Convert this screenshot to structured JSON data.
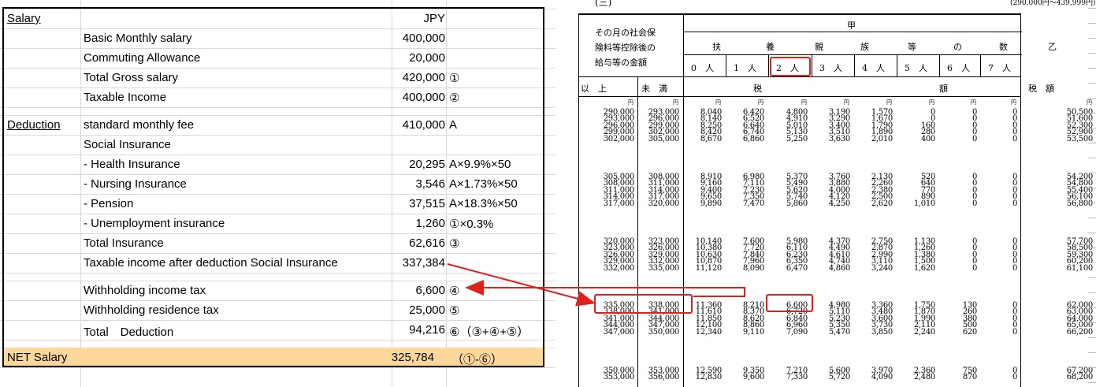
{
  "salary_sheet": {
    "rows": [
      {
        "label": "Salary",
        "item": "",
        "value": "JPY",
        "note": ""
      },
      {
        "label": "",
        "item": "Basic Monthly salary",
        "value": "400,000",
        "note": ""
      },
      {
        "label": "",
        "item": "Commuting Allowance",
        "value": "20,000",
        "note": ""
      },
      {
        "label": "",
        "item": "Total Gross salary",
        "value": "420,000",
        "note": "①"
      },
      {
        "label": "",
        "item": "Taxable Income",
        "value": "400,000",
        "note": "②"
      },
      {
        "label": "Deduction",
        "item": "standard monthly fee",
        "value": "410,000",
        "note": "A"
      },
      {
        "label": "",
        "item": "Social Insurance",
        "value": "",
        "note": ""
      },
      {
        "label": "",
        "item": "-  Health Insurance",
        "value": "20,295",
        "note": "A×9.9%×50"
      },
      {
        "label": "",
        "item": "-  Nursing Insurance",
        "value": "3,546",
        "note": "A×1.73%×50"
      },
      {
        "label": "",
        "item": "-  Pension",
        "value": "37,515",
        "note": "A×18.3%×50"
      },
      {
        "label": "",
        "item": "-  Unemployment insurance",
        "value": "1,260",
        "note": "①×0.3%"
      },
      {
        "label": "",
        "item": "Total Insurance",
        "value": "62,616",
        "note": "③"
      },
      {
        "label": "",
        "item": "Taxable income after deduction Social Insurance",
        "value": "337,384",
        "note": ""
      },
      {
        "label": "",
        "item": "Withholding income tax",
        "value": "6,600",
        "note": "④"
      },
      {
        "label": "",
        "item": "Withholding residence tax",
        "value": "25,000",
        "note": "⑤"
      },
      {
        "label": "",
        "item": "Total　Deduction",
        "value": "94,216",
        "note": "⑥（③+④+⑤）"
      },
      {
        "label": "NET Salary",
        "item": "",
        "value": "325,784",
        "note": "（①-⑥）"
      }
    ]
  },
  "tax_table": {
    "section_label": "(三)",
    "range_label": "(290,000円～439,999円)",
    "header": {
      "income_col": [
        "その月の社会保",
        "険料等控除後の",
        "給与等の金額"
      ],
      "kou": "甲",
      "dependents_title": [
        "扶",
        "養",
        "親",
        "族",
        "等",
        "の",
        "数"
      ],
      "dependents": [
        "0　人",
        "1　人",
        "2　人",
        "3　人",
        "4　人",
        "5　人",
        "6　人",
        "7　人"
      ],
      "otsu": "乙",
      "ijou": "以　上",
      "miman": "未　満",
      "zei": "税",
      "gaku": "額",
      "zeigaku": "税　額",
      "yen": "円"
    },
    "groups": [
      {
        "from": [
          "290,000",
          "293,000",
          "296,000",
          "299,000",
          "302,000"
        ],
        "to": [
          "293,000",
          "296,000",
          "299,000",
          "302,000",
          "305,000"
        ],
        "d0": [
          "8,040",
          "8,140",
          "8,250",
          "8,420",
          "8,670"
        ],
        "d1": [
          "6,420",
          "6,520",
          "6,640",
          "6,740",
          "6,860"
        ],
        "d2": [
          "4,800",
          "4,910",
          "5,010",
          "5,130",
          "5,250"
        ],
        "d3": [
          "3,190",
          "3,290",
          "3,400",
          "3,510",
          "3,630"
        ],
        "d4": [
          "1,570",
          "1,670",
          "1,790",
          "1,890",
          "2,010"
        ],
        "d5": [
          "0",
          "0",
          "160",
          "280",
          "400"
        ],
        "d6": [
          "0",
          "0",
          "0",
          "0",
          "0"
        ],
        "d7": [
          "0",
          "0",
          "0",
          "0",
          "0"
        ],
        "otsu": [
          "50,500",
          "51,600",
          "52,300",
          "52,900",
          "53,500"
        ]
      },
      {
        "from": [
          "305,000",
          "308,000",
          "311,000",
          "314,000",
          "317,000"
        ],
        "to": [
          "308,000",
          "311,000",
          "314,000",
          "317,000",
          "320,000"
        ],
        "d0": [
          "8,910",
          "9,160",
          "9,400",
          "9,650",
          "9,890"
        ],
        "d1": [
          "6,980",
          "7,110",
          "7,230",
          "7,350",
          "7,470"
        ],
        "d2": [
          "5,370",
          "5,490",
          "5,620",
          "5,740",
          "5,860"
        ],
        "d3": [
          "3,760",
          "3,880",
          "4,000",
          "4,120",
          "4,250"
        ],
        "d4": [
          "2,130",
          "2,260",
          "2,380",
          "2,500",
          "2,620"
        ],
        "d5": [
          "520",
          "640",
          "770",
          "890",
          "1,010"
        ],
        "d6": [
          "0",
          "0",
          "0",
          "0",
          "0"
        ],
        "d7": [
          "0",
          "0",
          "0",
          "0",
          "0"
        ],
        "otsu": [
          "54,200",
          "54,800",
          "55,400",
          "56,100",
          "56,800"
        ]
      },
      {
        "from": [
          "320,000",
          "323,000",
          "326,000",
          "329,000",
          "332,000"
        ],
        "to": [
          "323,000",
          "326,000",
          "329,000",
          "332,000",
          "335,000"
        ],
        "d0": [
          "10,140",
          "10,380",
          "10,630",
          "10,870",
          "11,120"
        ],
        "d1": [
          "7,600",
          "7,720",
          "7,840",
          "7,960",
          "8,090"
        ],
        "d2": [
          "5,980",
          "6,110",
          "6,230",
          "6,350",
          "6,470"
        ],
        "d3": [
          "4,370",
          "4,490",
          "4,610",
          "4,740",
          "4,860"
        ],
        "d4": [
          "2,750",
          "2,870",
          "2,990",
          "3,110",
          "3,240"
        ],
        "d5": [
          "1,130",
          "1,260",
          "1,380",
          "1,500",
          "1,620"
        ],
        "d6": [
          "0",
          "0",
          "0",
          "0",
          "0"
        ],
        "d7": [
          "0",
          "0",
          "0",
          "0",
          "0"
        ],
        "otsu": [
          "57,700",
          "58,500",
          "59,300",
          "60,200",
          "61,100"
        ]
      },
      {
        "from": [
          "335,000",
          "338,000",
          "341,000",
          "344,000",
          "347,000"
        ],
        "to": [
          "338,000",
          "341,000",
          "344,000",
          "347,000",
          "350,000"
        ],
        "d0": [
          "11,360",
          "11,610",
          "11,850",
          "12,100",
          "12,340"
        ],
        "d1": [
          "8,210",
          "8,370",
          "8,620",
          "8,860",
          "9,110"
        ],
        "d2": [
          "6,600",
          "6,720",
          "6,840",
          "6,960",
          "7,090"
        ],
        "d3": [
          "4,980",
          "5,110",
          "5,230",
          "5,350",
          "5,470"
        ],
        "d4": [
          "3,360",
          "3,480",
          "3,600",
          "3,730",
          "3,850"
        ],
        "d5": [
          "1,750",
          "1,870",
          "1,990",
          "2,110",
          "2,240"
        ],
        "d6": [
          "130",
          "260",
          "380",
          "500",
          "620"
        ],
        "d7": [
          "0",
          "0",
          "0",
          "0",
          "0"
        ],
        "otsu": [
          "62,000",
          "63,000",
          "64,000",
          "65,000",
          "66,200"
        ]
      },
      {
        "from": [
          "350,000",
          "353,000"
        ],
        "to": [
          "353,000",
          "356,000"
        ],
        "d0": [
          "12,590",
          "12,830"
        ],
        "d1": [
          "9,350",
          "9,600"
        ],
        "d2": [
          "7,210",
          "7,330"
        ],
        "d3": [
          "5,600",
          "5,720"
        ],
        "d4": [
          "3,970",
          "4,090"
        ],
        "d5": [
          "2,360",
          "2,480"
        ],
        "d6": [
          "750",
          "870"
        ],
        "d7": [
          "0",
          "0"
        ],
        "otsu": [
          "67,200",
          "68,200"
        ]
      }
    ]
  },
  "colors": {
    "net_fill": "#fdd89a",
    "annotation_red": "#e0201b"
  }
}
